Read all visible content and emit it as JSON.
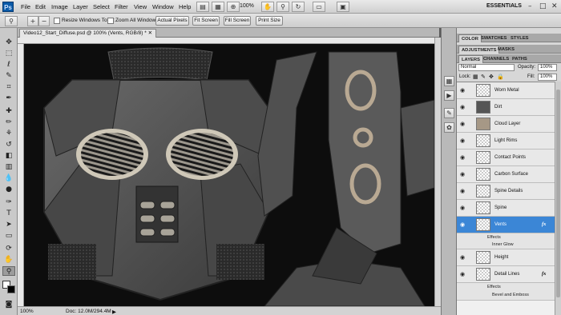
{
  "app": {
    "logo": "Ps",
    "menu": [
      "File",
      "Edit",
      "Image",
      "Layer",
      "Select",
      "Filter",
      "View",
      "Window",
      "Help"
    ],
    "zoom": "100%",
    "workspace": "ESSENTIALS",
    "window_controls": [
      "–",
      "□",
      "✕"
    ]
  },
  "options_bar": {
    "resize_windows_label": "Resize Windows To Fit",
    "zoom_all_windows_label": "Zoom All Windows",
    "buttons": [
      "Actual Pixels",
      "Fit Screen",
      "Fill Screen",
      "Print Size"
    ]
  },
  "document": {
    "tab_title": "Video12_Start_Diffuse.psd @ 100% (Vents, RGB/8) *",
    "status_zoom": "100%",
    "status_doc": "Doc: 12.0M/294.4M"
  },
  "panels": {
    "top_tabs": [
      "COLOR",
      "SWATCHES",
      "STYLES"
    ],
    "mid_tabs": [
      "ADJUSTMENTS",
      "MASKS"
    ],
    "layer_tabs": [
      "LAYERS",
      "CHANNELS",
      "PATHS"
    ],
    "blend_mode": "Normal",
    "opacity_label": "Opacity:",
    "opacity_value": "100%",
    "lock_label": "Lock:",
    "fill_label": "Fill:",
    "fill_value": "100%"
  },
  "layers": [
    {
      "name": "Worn Metal",
      "fx": false
    },
    {
      "name": "Dirt",
      "fx": false
    },
    {
      "name": "Cloud Layer",
      "fx": false
    },
    {
      "name": "Light Rims",
      "fx": false
    },
    {
      "name": "Contact Points",
      "fx": false
    },
    {
      "name": "Carbon Surface",
      "fx": false
    },
    {
      "name": "Spine Details",
      "fx": false
    },
    {
      "name": "Spine",
      "fx": false
    },
    {
      "name": "Vents",
      "fx": true,
      "selected": true,
      "effects_label": "Effects",
      "effects": [
        "Inner Glow"
      ]
    },
    {
      "name": "Height",
      "fx": false
    },
    {
      "name": "Detail Lines",
      "fx": true,
      "effects_label": "Effects",
      "effects": [
        "Bevel and Emboss"
      ]
    }
  ],
  "fx_label": "fx",
  "colors": {
    "selected_layer": "#3b86d6",
    "ps_logo": "#0a5aa8",
    "canvas_bg": "#0d0d0d"
  }
}
